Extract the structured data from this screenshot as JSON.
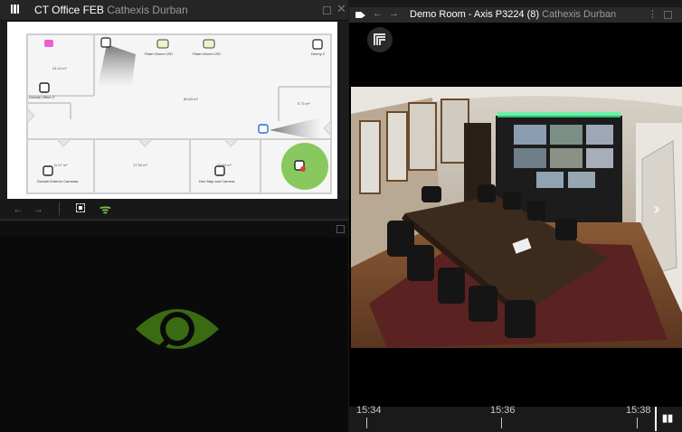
{
  "left_panel": {
    "title": "CT Office FEB",
    "subtitle": "Cathexis Durban",
    "map": {
      "areas": [
        "24.44 m²",
        "85.83 m²",
        "5.73 m²",
        "11.47 m²",
        "17.34 m²",
        "12.64 m²"
      ],
      "devices": [
        "Flash Green LED",
        "Flash Green LED",
        "Denny 2",
        "Durban Office 2",
        "Durban Exterior Cameras",
        "Den Map and Camera"
      ]
    }
  },
  "right_panel": {
    "title": "Demo Room - Axis P3224 (8)",
    "subtitle": "Cathexis Durban",
    "timeline": {
      "labels": [
        "15:34",
        "15:36",
        "15:38"
      ]
    }
  },
  "colors": {
    "accent_green": "#76c043",
    "eye_green": "#3a6a12",
    "header": "#262626"
  }
}
